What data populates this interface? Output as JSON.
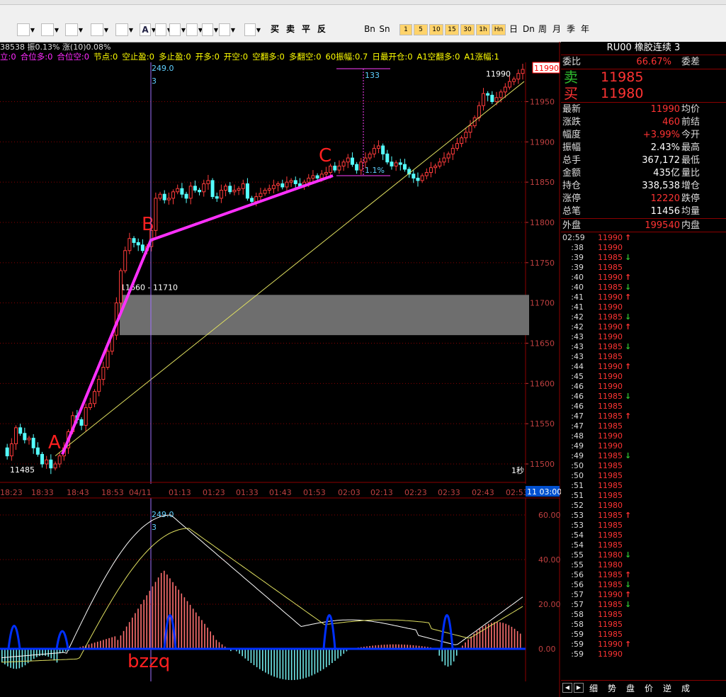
{
  "toolbar": {
    "buttons": [
      {
        "name": "trendline-tool-icon",
        "label": "",
        "x": 24,
        "w": 16
      },
      {
        "name": "channel-tool-icon",
        "label": "",
        "x": 58,
        "w": 16
      },
      {
        "name": "fib-tool-icon",
        "label": "",
        "x": 92,
        "w": 16
      },
      {
        "name": "rect-tool-icon",
        "label": "",
        "x": 128,
        "w": 16
      },
      {
        "name": "ellipse-tool-icon",
        "label": "",
        "x": 163,
        "w": 16
      },
      {
        "name": "text-tool-icon",
        "label": "A",
        "x": 197,
        "w": 14
      },
      {
        "name": "copy-tool-icon",
        "label": "",
        "x": 219,
        "w": 14
      },
      {
        "name": "erase-tool-icon",
        "label": "",
        "x": 239,
        "w": 14
      },
      {
        "name": "print-tool-icon",
        "label": "",
        "x": 263,
        "w": 14
      },
      {
        "name": "save-tool-icon",
        "label": "",
        "x": 285,
        "w": 14
      },
      {
        "name": "grid-tool-icon",
        "label": "",
        "x": 309,
        "w": 14
      },
      {
        "name": "layout-tool-icon",
        "label": "",
        "x": 345,
        "w": 14
      }
    ],
    "trade_buttons": [
      "买",
      "卖",
      "平",
      "反"
    ],
    "period_buttons": [
      "Bn",
      "Sn",
      "1",
      "5",
      "10",
      "15",
      "30",
      "1h",
      "Hn",
      "日",
      "Dn",
      "周",
      "月",
      "季",
      "年"
    ]
  },
  "status": {
    "text": "38538 振0.13% 涨(10)0.08%"
  },
  "indicators": [
    {
      "label": "立:0",
      "color": "#ff2aff"
    },
    {
      "label": "合位多:0",
      "color": "#ff2aff"
    },
    {
      "label": "合位空:0",
      "color": "#ff2aff"
    },
    {
      "label": "节点:0",
      "color": "#ffff00"
    },
    {
      "label": "空止盈:0",
      "color": "#ffff00"
    },
    {
      "label": "多止盈:0",
      "color": "#ffff00"
    },
    {
      "label": "开多:0",
      "color": "#ffff00"
    },
    {
      "label": "开空:0",
      "color": "#ffff00"
    },
    {
      "label": "空翻多:0",
      "color": "#ffff00"
    },
    {
      "label": "多翻空:0",
      "color": "#ffff00"
    },
    {
      "label": "60振幅:0.7",
      "color": "#ffff00"
    },
    {
      "label": "日最开仓:0",
      "color": "#ffff00"
    },
    {
      "label": "A1空翻多:0",
      "color": "#ffff00"
    },
    {
      "label": "A1涨幅:1",
      "color": "#ffff00"
    }
  ],
  "chart_data": {
    "type": "candlestick",
    "title": "RU00 橡胶连续",
    "x_labels": [
      "18:23",
      "18:33",
      "18:43",
      "18:53",
      "04/11",
      "01:13",
      "01:23",
      "01:33",
      "01:43",
      "01:53",
      "02:03",
      "02:13",
      "02:23",
      "02:33",
      "02:43",
      "02:53",
      "03:00"
    ],
    "y_ticks": [
      11500,
      11550,
      11600,
      11650,
      11700,
      11750,
      11800,
      11850,
      11900,
      11950
    ],
    "ylim": [
      11480,
      12000
    ],
    "price_series": [
      11520,
      11510,
      11525,
      11545,
      11538,
      11530,
      11532,
      11520,
      11512,
      11500,
      11505,
      11495,
      11500,
      11510,
      11520,
      11540,
      11560,
      11555,
      11548,
      11570,
      11575,
      11590,
      11605,
      11620,
      11640,
      11660,
      11700,
      11740,
      11765,
      11780,
      11775,
      11772,
      11765,
      11770,
      11790,
      11830,
      11835,
      11828,
      11830,
      11838,
      11842,
      11835,
      11830,
      11845,
      11840,
      11838,
      11848,
      11852,
      11832,
      11830,
      11840,
      11845,
      11838,
      11840,
      11842,
      11848,
      11830,
      11826,
      11832,
      11836,
      11840,
      11842,
      11846,
      11848,
      11844,
      11850,
      11852,
      11848,
      11845,
      11850,
      11855,
      11858,
      11855,
      11860,
      11862,
      11870,
      11865,
      11870,
      11875,
      11880,
      11872,
      11865,
      11875,
      11880,
      11885,
      11892,
      11895,
      11885,
      11875,
      11870,
      11874,
      11872,
      11866,
      11860,
      11855,
      11852,
      11858,
      11862,
      11868,
      11870,
      11875,
      11880,
      11885,
      11892,
      11898,
      11905,
      11912,
      11920,
      11930,
      11945,
      11960,
      11958,
      11950,
      11955,
      11962,
      11968,
      11975,
      11978,
      11985,
      11990
    ],
    "average_line": {
      "start": 11510,
      "end": 11975
    },
    "annotations": {
      "points": [
        {
          "label": "A",
          "price": 11512
        },
        {
          "label": "B",
          "price": 11778
        },
        {
          "label": "C",
          "price": 11858
        }
      ],
      "zone_label": "11660 - 11710",
      "zone_low": 11660,
      "zone_high": 11710,
      "low_label": "11485",
      "high_label": "11990",
      "crosshair_value": "249.0",
      "crosshair_sub": "3",
      "measure_label": "133",
      "pct_label": "1.1%",
      "current_price": "11990",
      "period_label": "1秒",
      "end_time": "11 03:00"
    }
  },
  "sub_chart": {
    "y_ticks": [
      "60.00",
      "40.00",
      "20.00",
      "0.00"
    ],
    "crosshair_value": "249.0",
    "crosshair_sub": "3",
    "label": "bzzq"
  },
  "quote": {
    "title": "RU00  橡胶连续  3",
    "wei_bi": {
      "label": "委比",
      "value": "66.67%",
      "label2": "委差"
    },
    "sell": {
      "label": "卖",
      "price": "11985"
    },
    "buy": {
      "label": "买",
      "price": "11980"
    },
    "rows": [
      {
        "l1": "最新",
        "v1": "11990",
        "c1": "#ff3333",
        "l2": "均价"
      },
      {
        "l1": "涨跌",
        "v1": "460",
        "c1": "#ff3333",
        "l2": "前结"
      },
      {
        "l1": "幅度",
        "v1": "+3.99%",
        "c1": "#ff3333",
        "l2": "今开"
      },
      {
        "l1": "振幅",
        "v1": "2.43%",
        "c1": "#ffffff",
        "l2": "最高"
      },
      {
        "l1": "总手",
        "v1": "367,172",
        "c1": "#ffffff",
        "l2": "最低"
      },
      {
        "l1": "金额",
        "v1": "435亿",
        "c1": "#ffffff",
        "l2": "量比"
      },
      {
        "l1": "持仓",
        "v1": "338,538",
        "c1": "#ffffff",
        "l2": "增仓"
      },
      {
        "l1": "涨停",
        "v1": "12220",
        "c1": "#ff3333",
        "l2": "跌停"
      },
      {
        "l1": "总笔",
        "v1": "11456",
        "c1": "#ffffff",
        "l2": "均量"
      }
    ],
    "outer": {
      "label": "外盘",
      "value": "199540",
      "label2": "内盘"
    },
    "ticks": [
      {
        "t": "02:59",
        "p": "11990",
        "a": "up"
      },
      {
        "t": ":38",
        "p": "11990",
        "a": ""
      },
      {
        "t": ":39",
        "p": "11985",
        "a": "down"
      },
      {
        "t": ":39",
        "p": "11985",
        "a": ""
      },
      {
        "t": ":40",
        "p": "11990",
        "a": "up"
      },
      {
        "t": ":40",
        "p": "11985",
        "a": "down"
      },
      {
        "t": ":41",
        "p": "11990",
        "a": "up"
      },
      {
        "t": ":41",
        "p": "11990",
        "a": ""
      },
      {
        "t": ":42",
        "p": "11985",
        "a": "down"
      },
      {
        "t": ":42",
        "p": "11990",
        "a": "up"
      },
      {
        "t": ":43",
        "p": "11990",
        "a": ""
      },
      {
        "t": ":43",
        "p": "11985",
        "a": "down"
      },
      {
        "t": ":43",
        "p": "11985",
        "a": ""
      },
      {
        "t": ":44",
        "p": "11990",
        "a": "up"
      },
      {
        "t": ":45",
        "p": "11990",
        "a": ""
      },
      {
        "t": ":46",
        "p": "11990",
        "a": ""
      },
      {
        "t": ":46",
        "p": "11985",
        "a": "down"
      },
      {
        "t": ":46",
        "p": "11985",
        "a": ""
      },
      {
        "t": ":47",
        "p": "11985",
        "a": "up"
      },
      {
        "t": ":47",
        "p": "11985",
        "a": ""
      },
      {
        "t": ":48",
        "p": "11990",
        "a": ""
      },
      {
        "t": ":49",
        "p": "11990",
        "a": ""
      },
      {
        "t": ":49",
        "p": "11985",
        "a": "down"
      },
      {
        "t": ":50",
        "p": "11985",
        "a": ""
      },
      {
        "t": ":50",
        "p": "11985",
        "a": ""
      },
      {
        "t": ":51",
        "p": "11985",
        "a": ""
      },
      {
        "t": ":51",
        "p": "11985",
        "a": ""
      },
      {
        "t": ":52",
        "p": "11980",
        "a": ""
      },
      {
        "t": ":53",
        "p": "11985",
        "a": "up"
      },
      {
        "t": ":53",
        "p": "11985",
        "a": ""
      },
      {
        "t": ":54",
        "p": "11985",
        "a": ""
      },
      {
        "t": ":54",
        "p": "11985",
        "a": ""
      },
      {
        "t": ":55",
        "p": "11980",
        "a": "down"
      },
      {
        "t": ":55",
        "p": "11980",
        "a": ""
      },
      {
        "t": ":56",
        "p": "11985",
        "a": "up"
      },
      {
        "t": ":56",
        "p": "11985",
        "a": "down"
      },
      {
        "t": ":57",
        "p": "11990",
        "a": "up"
      },
      {
        "t": ":57",
        "p": "11985",
        "a": "down"
      },
      {
        "t": ":58",
        "p": "11985",
        "a": ""
      },
      {
        "t": ":58",
        "p": "11985",
        "a": ""
      },
      {
        "t": ":59",
        "p": "11985",
        "a": ""
      },
      {
        "t": ":59",
        "p": "11990",
        "a": "up"
      },
      {
        "t": ":59",
        "p": "11990",
        "a": ""
      }
    ],
    "bottom_tabs": [
      "细",
      "势",
      "盘",
      "价",
      "逆",
      "成"
    ]
  }
}
